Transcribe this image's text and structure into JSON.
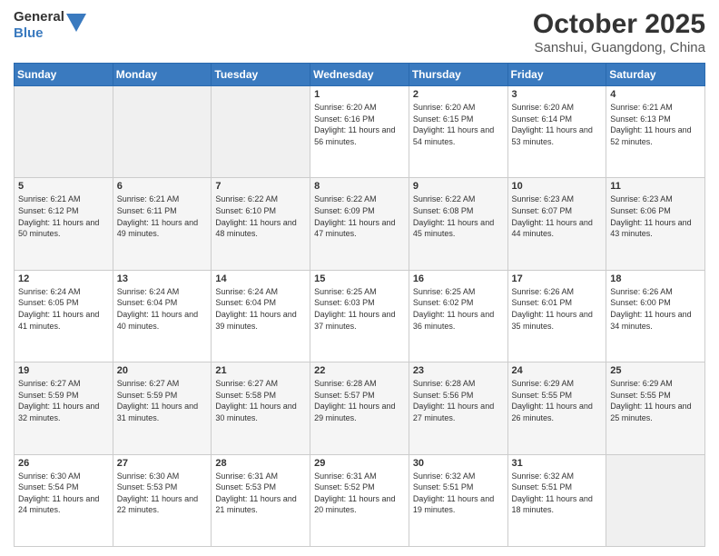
{
  "header": {
    "logo_line1": "General",
    "logo_line2": "Blue",
    "month_title": "October 2025",
    "location": "Sanshui, Guangdong, China"
  },
  "days_of_week": [
    "Sunday",
    "Monday",
    "Tuesday",
    "Wednesday",
    "Thursday",
    "Friday",
    "Saturday"
  ],
  "rows": [
    {
      "cells": [
        {
          "day": "",
          "empty": true
        },
        {
          "day": "",
          "empty": true
        },
        {
          "day": "",
          "empty": true
        },
        {
          "day": "1",
          "sunrise": "6:20 AM",
          "sunset": "6:16 PM",
          "daylight": "11 hours and 56 minutes."
        },
        {
          "day": "2",
          "sunrise": "6:20 AM",
          "sunset": "6:15 PM",
          "daylight": "11 hours and 54 minutes."
        },
        {
          "day": "3",
          "sunrise": "6:20 AM",
          "sunset": "6:14 PM",
          "daylight": "11 hours and 53 minutes."
        },
        {
          "day": "4",
          "sunrise": "6:21 AM",
          "sunset": "6:13 PM",
          "daylight": "11 hours and 52 minutes."
        }
      ]
    },
    {
      "cells": [
        {
          "day": "5",
          "sunrise": "6:21 AM",
          "sunset": "6:12 PM",
          "daylight": "11 hours and 50 minutes."
        },
        {
          "day": "6",
          "sunrise": "6:21 AM",
          "sunset": "6:11 PM",
          "daylight": "11 hours and 49 minutes."
        },
        {
          "day": "7",
          "sunrise": "6:22 AM",
          "sunset": "6:10 PM",
          "daylight": "11 hours and 48 minutes."
        },
        {
          "day": "8",
          "sunrise": "6:22 AM",
          "sunset": "6:09 PM",
          "daylight": "11 hours and 47 minutes."
        },
        {
          "day": "9",
          "sunrise": "6:22 AM",
          "sunset": "6:08 PM",
          "daylight": "11 hours and 45 minutes."
        },
        {
          "day": "10",
          "sunrise": "6:23 AM",
          "sunset": "6:07 PM",
          "daylight": "11 hours and 44 minutes."
        },
        {
          "day": "11",
          "sunrise": "6:23 AM",
          "sunset": "6:06 PM",
          "daylight": "11 hours and 43 minutes."
        }
      ]
    },
    {
      "cells": [
        {
          "day": "12",
          "sunrise": "6:24 AM",
          "sunset": "6:05 PM",
          "daylight": "11 hours and 41 minutes."
        },
        {
          "day": "13",
          "sunrise": "6:24 AM",
          "sunset": "6:04 PM",
          "daylight": "11 hours and 40 minutes."
        },
        {
          "day": "14",
          "sunrise": "6:24 AM",
          "sunset": "6:04 PM",
          "daylight": "11 hours and 39 minutes."
        },
        {
          "day": "15",
          "sunrise": "6:25 AM",
          "sunset": "6:03 PM",
          "daylight": "11 hours and 37 minutes."
        },
        {
          "day": "16",
          "sunrise": "6:25 AM",
          "sunset": "6:02 PM",
          "daylight": "11 hours and 36 minutes."
        },
        {
          "day": "17",
          "sunrise": "6:26 AM",
          "sunset": "6:01 PM",
          "daylight": "11 hours and 35 minutes."
        },
        {
          "day": "18",
          "sunrise": "6:26 AM",
          "sunset": "6:00 PM",
          "daylight": "11 hours and 34 minutes."
        }
      ]
    },
    {
      "cells": [
        {
          "day": "19",
          "sunrise": "6:27 AM",
          "sunset": "5:59 PM",
          "daylight": "11 hours and 32 minutes."
        },
        {
          "day": "20",
          "sunrise": "6:27 AM",
          "sunset": "5:59 PM",
          "daylight": "11 hours and 31 minutes."
        },
        {
          "day": "21",
          "sunrise": "6:27 AM",
          "sunset": "5:58 PM",
          "daylight": "11 hours and 30 minutes."
        },
        {
          "day": "22",
          "sunrise": "6:28 AM",
          "sunset": "5:57 PM",
          "daylight": "11 hours and 29 minutes."
        },
        {
          "day": "23",
          "sunrise": "6:28 AM",
          "sunset": "5:56 PM",
          "daylight": "11 hours and 27 minutes."
        },
        {
          "day": "24",
          "sunrise": "6:29 AM",
          "sunset": "5:55 PM",
          "daylight": "11 hours and 26 minutes."
        },
        {
          "day": "25",
          "sunrise": "6:29 AM",
          "sunset": "5:55 PM",
          "daylight": "11 hours and 25 minutes."
        }
      ]
    },
    {
      "cells": [
        {
          "day": "26",
          "sunrise": "6:30 AM",
          "sunset": "5:54 PM",
          "daylight": "11 hours and 24 minutes."
        },
        {
          "day": "27",
          "sunrise": "6:30 AM",
          "sunset": "5:53 PM",
          "daylight": "11 hours and 22 minutes."
        },
        {
          "day": "28",
          "sunrise": "6:31 AM",
          "sunset": "5:53 PM",
          "daylight": "11 hours and 21 minutes."
        },
        {
          "day": "29",
          "sunrise": "6:31 AM",
          "sunset": "5:52 PM",
          "daylight": "11 hours and 20 minutes."
        },
        {
          "day": "30",
          "sunrise": "6:32 AM",
          "sunset": "5:51 PM",
          "daylight": "11 hours and 19 minutes."
        },
        {
          "day": "31",
          "sunrise": "6:32 AM",
          "sunset": "5:51 PM",
          "daylight": "11 hours and 18 minutes."
        },
        {
          "day": "",
          "empty": true
        }
      ]
    }
  ],
  "labels": {
    "sunrise": "Sunrise:",
    "sunset": "Sunset:",
    "daylight": "Daylight:"
  }
}
